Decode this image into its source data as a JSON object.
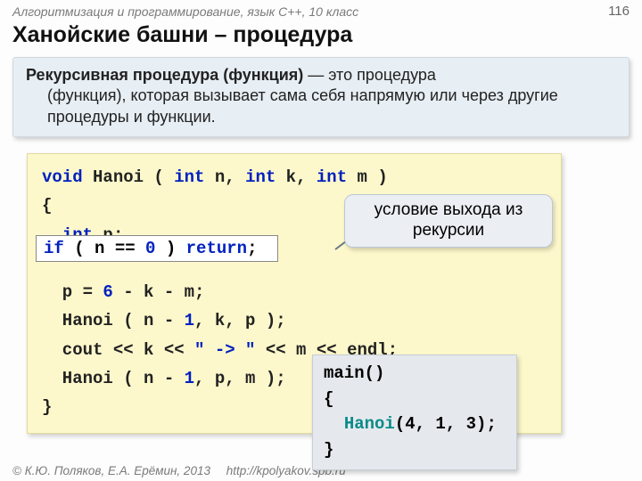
{
  "header": {
    "course": "Алгоритмизация и программирование, язык  C++, 10 класс",
    "page": "116"
  },
  "title": "Ханойские башни – процедура",
  "definition": {
    "term": "Рекурсивная процедура (функция)",
    "dash": " — это процедура",
    "rest": "(функция), которая вызывает сама себя напрямую или через другие процедуры и функции."
  },
  "code": {
    "sig_void": "void",
    "sig_name": " Hanoi ( ",
    "sig_t1": "int",
    "sig_p1": " n, ",
    "sig_t2": "int",
    "sig_p2": " k, ",
    "sig_t3": "int",
    "sig_p3": " m )",
    "open": "{",
    "decl_int": "int",
    "decl_p": " p;",
    "if_kw": "if",
    "if_cond": " ( n == ",
    "zero": "0",
    "if_close": " ) ",
    "ret_kw": "return",
    "semi": ";",
    "assign": "  p = ",
    "six": "6",
    "assign2": " - k - m;",
    "call1a": "  Hanoi ( n - ",
    "one1": "1",
    "call1b": ", k, p );",
    "cout1": "  cout << k << ",
    "arrow": "\" -> \"",
    "cout2": " << m << endl;",
    "call2a": "  Hanoi ( n - ",
    "one2": "1",
    "call2b": ", p, m );",
    "close": "}"
  },
  "highlight": {
    "if_kw": "if",
    "cond_open": " ( n == ",
    "zero": "0",
    "cond_close": " ) ",
    "ret": "return",
    "semi": ";"
  },
  "callout": {
    "line1": "условие выхода из",
    "line2": "рекурсии"
  },
  "main": {
    "l1": "main()",
    "l2": "{",
    "l3_indent": "  ",
    "l3_call": "Hanoi",
    "l3_args": "(4, 1, 3);",
    "l4": "}"
  },
  "footer": {
    "copyright": "© К.Ю. Поляков, Е.А. Ерёмин, 2013",
    "url": "http://kpolyakov.spb.ru"
  }
}
